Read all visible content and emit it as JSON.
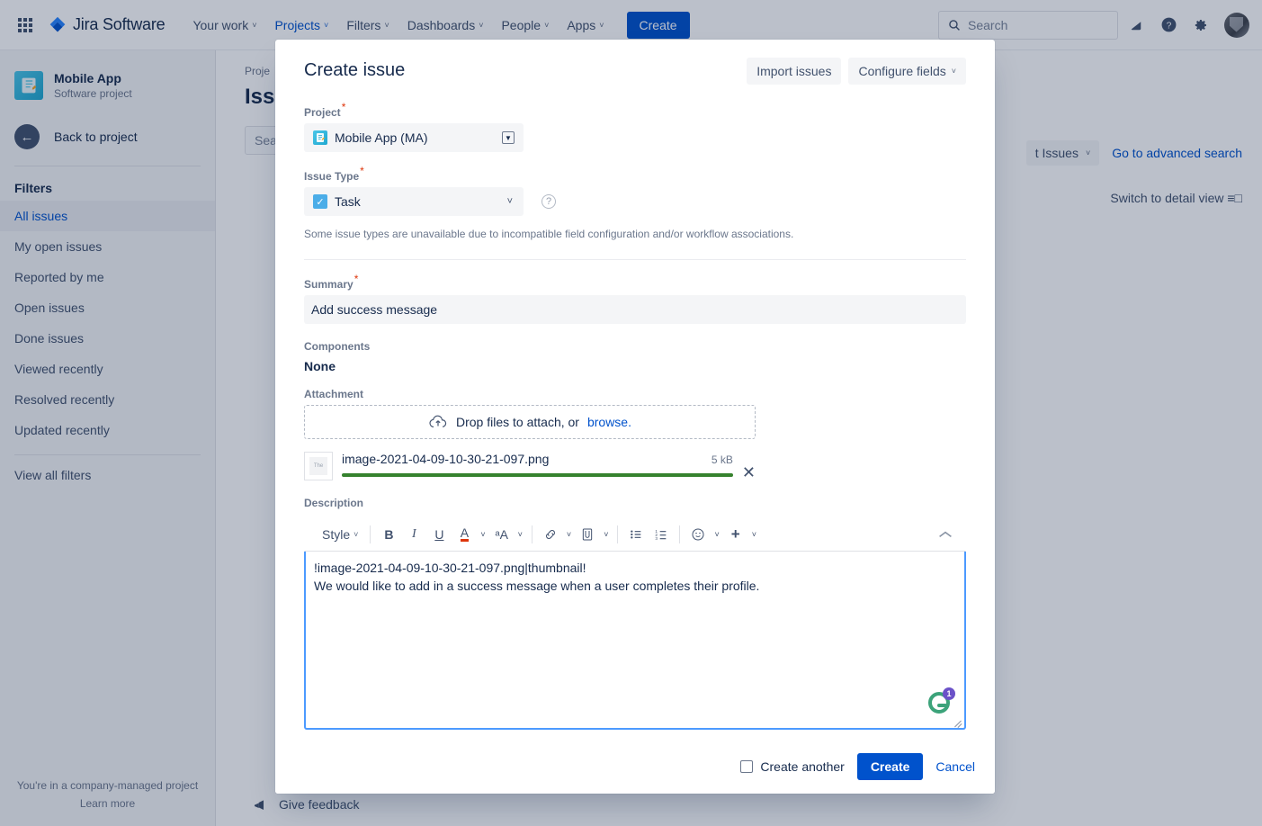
{
  "topnav": {
    "app_switcher_icon": "grid-icon",
    "brand": "Jira Software",
    "items": [
      {
        "label": "Your work",
        "caret": "˅",
        "active": false
      },
      {
        "label": "Projects",
        "caret": "˅",
        "active": true
      },
      {
        "label": "Filters",
        "caret": "˅",
        "active": false
      },
      {
        "label": "Dashboards",
        "caret": "˅",
        "active": false
      },
      {
        "label": "People",
        "caret": "˅",
        "active": false
      },
      {
        "label": "Apps",
        "caret": "˅",
        "active": false
      }
    ],
    "create_label": "Create",
    "search_placeholder": "Search",
    "search_value": "",
    "icons": [
      "notifications-icon",
      "help-icon",
      "settings-icon",
      "avatar"
    ]
  },
  "sidebar": {
    "project_name": "Mobile App",
    "project_type": "Software project",
    "back_label": "Back to project",
    "section_title": "Filters",
    "items": [
      {
        "label": "All issues",
        "selected": true
      },
      {
        "label": "My open issues",
        "selected": false
      },
      {
        "label": "Reported by me",
        "selected": false
      },
      {
        "label": "Open issues",
        "selected": false
      },
      {
        "label": "Done issues",
        "selected": false
      },
      {
        "label": "Viewed recently",
        "selected": false
      },
      {
        "label": "Resolved recently",
        "selected": false
      },
      {
        "label": "Updated recently",
        "selected": false
      }
    ],
    "view_all": "View all filters",
    "footer_line1": "You're in a company-managed project",
    "footer_line2": "Learn more"
  },
  "background": {
    "breadcrumb": "Proje",
    "page_title": "Issu",
    "search_placeholder": "Sea",
    "filter_pill": "t Issues",
    "advanced_search": "Go to advanced search",
    "detail_view": "Switch to detail view",
    "give_feedback": "Give feedback"
  },
  "modal": {
    "title": "Create issue",
    "import_issues": "Import issues",
    "configure_fields": "Configure fields",
    "project": {
      "label": "Project",
      "required": "*",
      "value": "Mobile App (MA)"
    },
    "issue_type": {
      "label": "Issue Type",
      "required": "*",
      "value": "Task",
      "hint": "Some issue types are unavailable due to incompatible field configuration and/or workflow associations."
    },
    "summary": {
      "label": "Summary",
      "required": "*",
      "value": "Add success message",
      "placeholder": ""
    },
    "components": {
      "label": "Components",
      "value": "None"
    },
    "attachment": {
      "label": "Attachment",
      "dropzone_text": "Drop files to attach, or",
      "dropzone_link": "browse.",
      "file_name": "image-2021-04-09-10-30-21-097.png",
      "file_size": "5 kB",
      "progress_percent": 100,
      "progress_color": "#36822e",
      "thumb_text": "The"
    },
    "description": {
      "label": "Description",
      "toolbar": {
        "style_label": "Style",
        "bold": "B",
        "italic": "I",
        "underline": "U",
        "text_color": "A",
        "text_color_bar": "#de350b",
        "more_formatting": "ᵃA",
        "link": "link-icon",
        "attach": "attach-icon",
        "bullet_list": "bullet-list-icon",
        "numbered_list": "numbered-list-icon",
        "emoji": "emoji-icon",
        "insert_more": "+",
        "collapse": "collapse-icon"
      },
      "line1": "!image-2021-04-09-10-30-21-097.png|thumbnail!",
      "line2": "We would like to add in a success message when a user completes their profile.",
      "grammarly_badge": "1"
    },
    "footer": {
      "create_another_label": "Create another",
      "create_another_checked": false,
      "create_label": "Create",
      "cancel_label": "Cancel"
    }
  },
  "colors": {
    "brand_blue": "#0052cc",
    "link_blue": "#0052cc",
    "focus_blue": "#4c9aff",
    "required_red": "#de350b",
    "progress_green": "#36822e",
    "text_dark": "#172b4d",
    "text_subtle": "#6b778c"
  }
}
